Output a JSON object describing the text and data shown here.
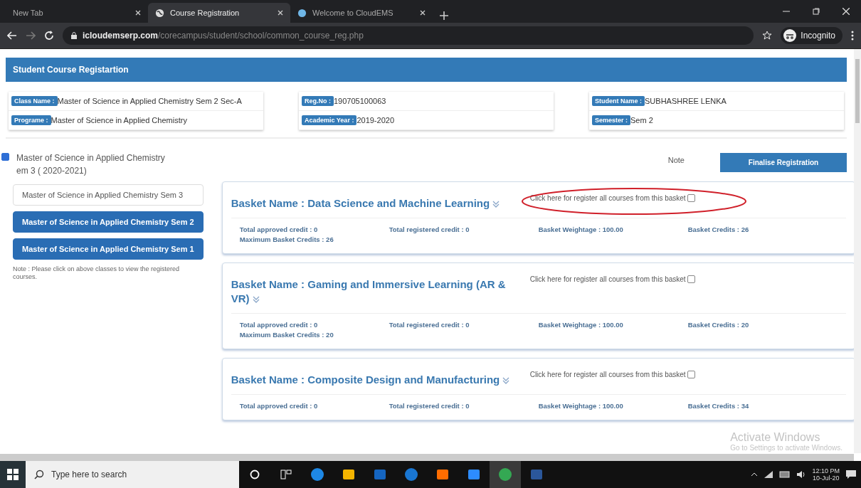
{
  "browser": {
    "tabs": [
      {
        "title": "New Tab",
        "selected": false
      },
      {
        "title": "Course Registration",
        "selected": true
      },
      {
        "title": "Welcome to  CloudEMS",
        "selected": false
      }
    ],
    "url_domain": "icloudemserp.com",
    "url_path": "/corecampus/student/school/common_course_reg.php",
    "profile": "Incognito"
  },
  "page_title": "Student Course Registartion",
  "info_cards": [
    [
      {
        "label": "Class Name :",
        "value": "Master of Science in Applied Chemistry Sem 2 Sec-A"
      },
      {
        "label": "Programe :",
        "value": "Master of Science in Applied Chemistry"
      }
    ],
    [
      {
        "label": "Reg.No :",
        "value": "190705100063"
      },
      {
        "label": "Academic Year :",
        "value": "2019-2020"
      }
    ],
    [
      {
        "label": "Student Name :",
        "value": "SUBHASHREE LENKA"
      },
      {
        "label": "Semester :",
        "value": "Sem 2"
      }
    ]
  ],
  "next_semester": {
    "checked": true,
    "label_lines": [
      "Master of Science in Applied Chemistry",
      "em 3 ( 2020-2021)"
    ]
  },
  "note_label": "Note",
  "finalise_button": "Finalise Registration",
  "classes": [
    {
      "label": "Master of Science in Applied Chemistry Sem 3",
      "selected": true
    },
    {
      "label": "Master of Science in Applied Chemistry Sem 2",
      "selected": false
    },
    {
      "label": "Master of Science in Applied Chemistry Sem 1",
      "selected": false
    }
  ],
  "classes_note": "Note : Please click on above classes to view the registered courses.",
  "baskets": [
    {
      "name": "Basket Name : Data Science and Machine Learning",
      "register_label": "Click here for register all courses from this basket",
      "register_checked": false,
      "highlighted": true,
      "stats": [
        "Total approved credit : 0",
        "Total registered credit : 0",
        "Basket Weightage : 100.00",
        "Basket Credits : 26"
      ],
      "max_credits": "Maximum Basket Credits : 26"
    },
    {
      "name": "Basket Name : Gaming and Immersive Learning (AR & VR)",
      "register_label": "Click here for register all courses from this basket",
      "register_checked": false,
      "highlighted": false,
      "stats": [
        "Total approved credit : 0",
        "Total registered credit : 0",
        "Basket Weightage : 100.00",
        "Basket Credits : 20"
      ],
      "max_credits": "Maximum Basket Credits : 20"
    },
    {
      "name": "Basket Name : Composite Design and Manufacturing",
      "register_label": "Click here for register all courses from this basket",
      "register_checked": false,
      "highlighted": false,
      "stats": [
        "Total approved credit : 0",
        "Total registered credit : 0",
        "Basket Weightage : 100.00",
        "Basket Credits : 34"
      ]
    }
  ],
  "activation": {
    "title": "Activate Windows",
    "subtitle": "Go to Settings to activate Windows."
  },
  "taskbar": {
    "search_placeholder": "Type here to search",
    "time": "12:10 PM",
    "date": "10-Jul-20"
  }
}
